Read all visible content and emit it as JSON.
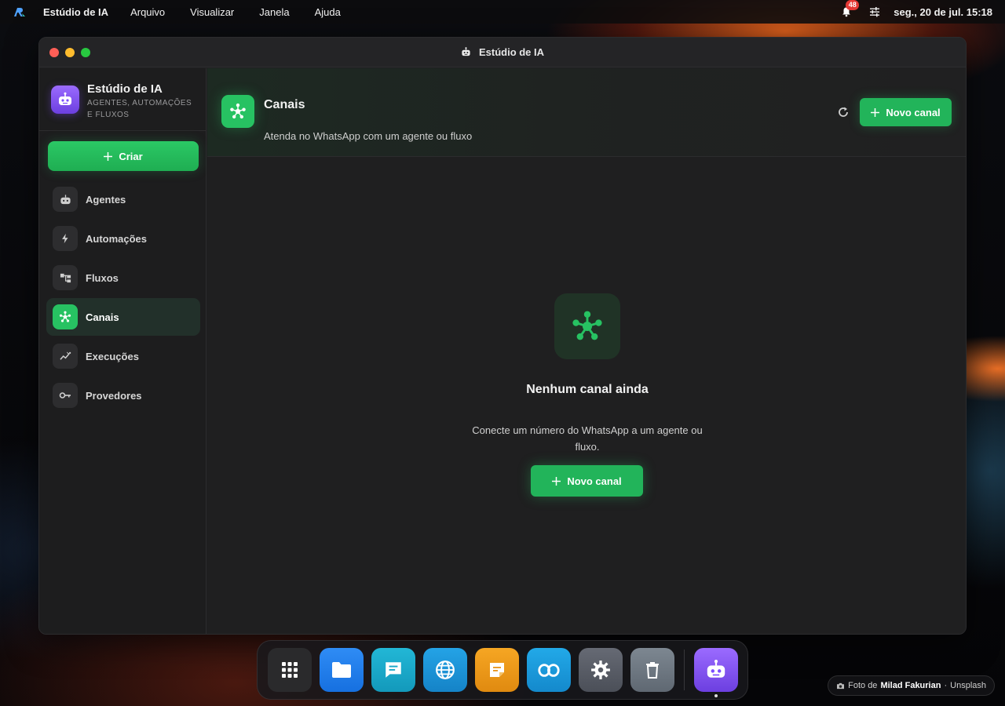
{
  "menubar": {
    "app_name": "Estúdio de IA",
    "menus": [
      "Arquivo",
      "Visualizar",
      "Janela",
      "Ajuda"
    ],
    "notification_count": "48",
    "clock": "seg., 20 de jul. 15:18"
  },
  "window": {
    "title": "Estúdio de IA"
  },
  "sidebar": {
    "brand_title": "Estúdio de IA",
    "brand_subtitle": "AGENTES, AUTOMAÇÕES E FLUXOS",
    "create_label": "Criar",
    "items": [
      {
        "label": "Agentes",
        "icon": "robot-icon"
      },
      {
        "label": "Automações",
        "icon": "bolt-icon"
      },
      {
        "label": "Fluxos",
        "icon": "flow-icon"
      },
      {
        "label": "Canais",
        "icon": "hub-icon",
        "active": true
      },
      {
        "label": "Execuções",
        "icon": "activity-icon"
      },
      {
        "label": "Provedores",
        "icon": "key-icon"
      }
    ]
  },
  "main": {
    "title": "Canais",
    "subtitle": "Atenda no WhatsApp com um agente ou fluxo",
    "new_button": "Novo canal",
    "empty_title": "Nenhum canal ainda",
    "empty_desc": "Conecte um número do WhatsApp a um agente ou fluxo.",
    "empty_button": "Novo canal"
  },
  "dock": {
    "items": [
      "apps-grid-icon",
      "files-icon",
      "chat-icon",
      "globe-icon",
      "notes-icon",
      "link-icon",
      "settings-icon",
      "trash-icon",
      "ai-studio-icon"
    ]
  },
  "credit": {
    "prefix": "Foto de",
    "author": "Milad Fakurian",
    "separator": "·",
    "source": "Unsplash"
  },
  "colors": {
    "accent_green": "#22b45a",
    "brand_purple": "#7c4dff",
    "badge_red": "#e53935"
  }
}
